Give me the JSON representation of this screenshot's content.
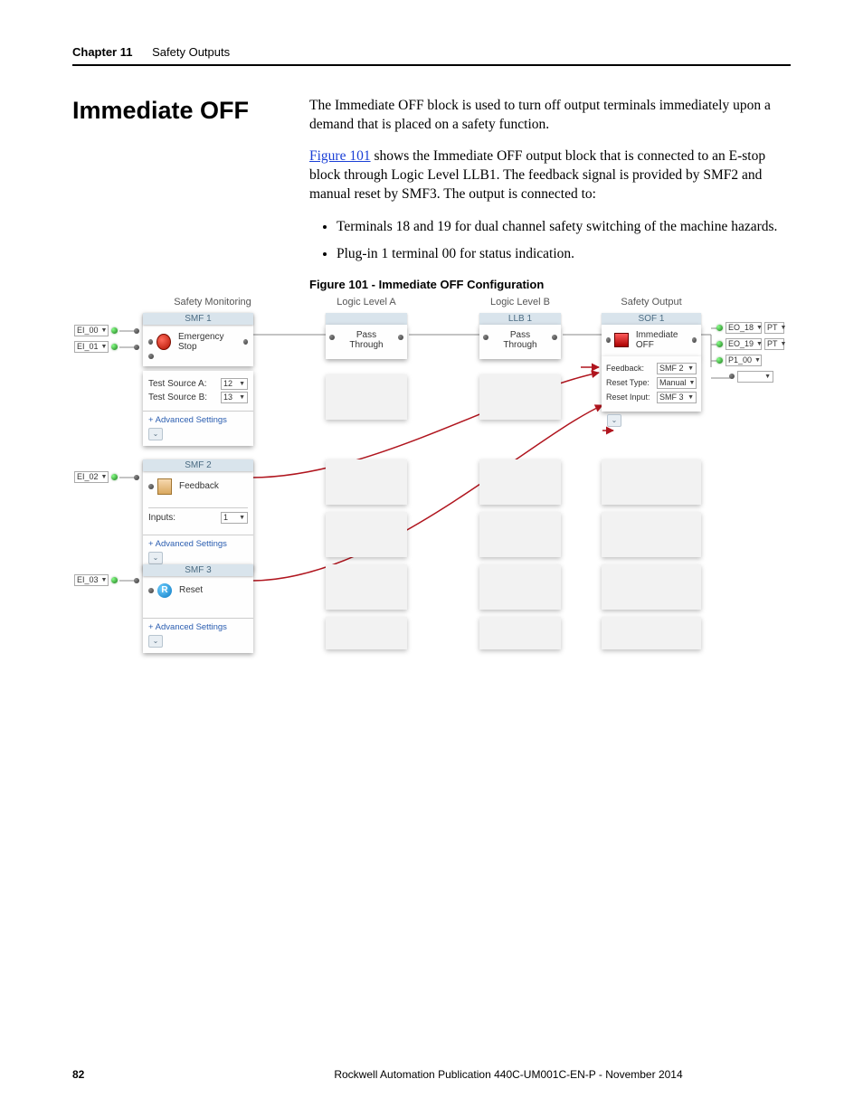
{
  "header": {
    "chapter": "Chapter 11",
    "title": "Safety Outputs"
  },
  "section": {
    "title": "Immediate OFF",
    "p1": "The Immediate OFF block is used to turn off output terminals immediately upon a demand that is placed on a safety function.",
    "p2a": "Figure 101",
    "p2b": " shows the Immediate OFF output block that is connected to an E-stop block through Logic Level LLB1. The feedback signal is provided by SMF2 and manual reset by SMF3. The output is connected to:",
    "bullets": [
      "Terminals 18 and 19 for dual channel safety switching of the machine hazards.",
      "Plug-in 1 terminal 00 for status indication."
    ],
    "figcaption": "Figure 101 - Immediate OFF Configuration"
  },
  "diagram": {
    "columns": {
      "safety_monitoring": "Safety Monitoring",
      "logic_a": "Logic Level A",
      "logic_b": "Logic Level B",
      "safety_output": "Safety Output"
    },
    "inputs": {
      "ei00": "EI_00",
      "ei01": "EI_01",
      "ei02": "EI_02",
      "ei03": "EI_03"
    },
    "smf1": {
      "title": "SMF 1",
      "label": "Emergency Stop",
      "testA_label": "Test Source A:",
      "testA_val": "12",
      "testB_label": "Test Source B:",
      "testB_val": "13",
      "adv": "Advanced Settings"
    },
    "smf2": {
      "title": "SMF 2",
      "label": "Feedback",
      "inputs_label": "Inputs:",
      "inputs_val": "1",
      "adv": "Advanced Settings"
    },
    "smf3": {
      "title": "SMF 3",
      "label": "Reset",
      "reset_letter": "R",
      "adv": "Advanced Settings"
    },
    "pass": {
      "label1": "Pass",
      "label2": "Through"
    },
    "llb1": {
      "title": "LLB 1"
    },
    "sof1": {
      "title": "SOF 1",
      "label": "Immediate OFF",
      "feedback_label": "Feedback:",
      "feedback_val": "SMF 2",
      "reset_type_label": "Reset Type:",
      "reset_type_val": "Manual",
      "reset_input_label": "Reset Input:",
      "reset_input_val": "SMF 3"
    },
    "outputs": {
      "eo18": "EO_18",
      "eo18_pt": "PT",
      "eo19": "EO_19",
      "eo19_pt": "PT",
      "p100": "P1_00"
    }
  },
  "footer": {
    "page": "82",
    "pub": "Rockwell Automation Publication 440C-UM001C-EN-P - November 2014"
  }
}
